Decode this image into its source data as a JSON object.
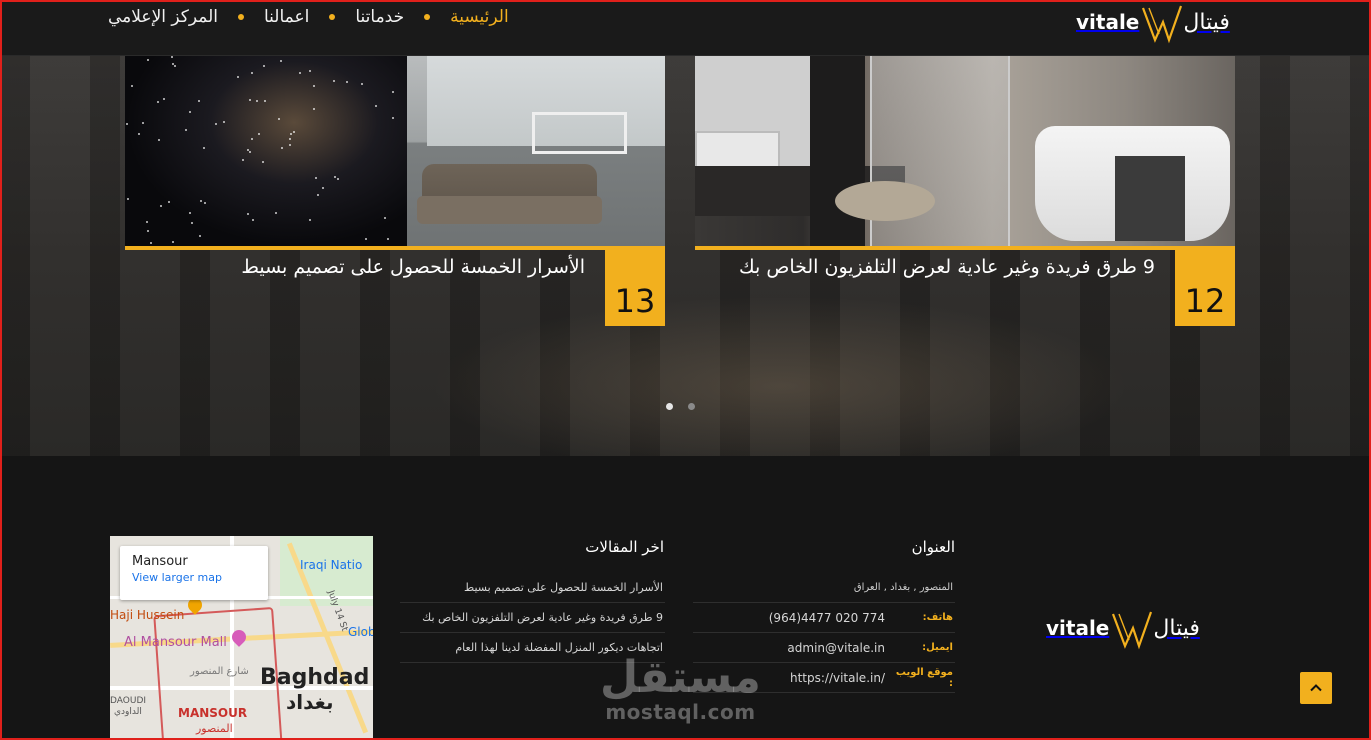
{
  "header": {
    "nav": [
      {
        "label": "الرئيسية",
        "active": true
      },
      {
        "label": "خدماتنا",
        "active": false
      },
      {
        "label": "اعمالنا",
        "active": false
      },
      {
        "label": "المركز الإعلامي",
        "active": false
      }
    ],
    "logo_latin": "vitale",
    "logo_arabic": "فيتال"
  },
  "slider": {
    "cards": [
      {
        "number": "12",
        "title": "9 طرق فريدة وغير عادية لعرض التلفزيون الخاص بك",
        "image": "bathroom-image"
      },
      {
        "number": "13",
        "title": "الأسرار الخمسة للحصول على تصميم بسيط",
        "image": "space-living-room-image"
      }
    ],
    "active_dot": 0,
    "dot_count": 2
  },
  "footer": {
    "address": {
      "title": "العنوان",
      "location": "المنصور , بغداد , العراق",
      "phone_label": "هاتف:",
      "phone": "(964)4477 020 774",
      "email_label": "ايميل:",
      "email": "admin@vitale.in",
      "website_label": "موقع الويب :",
      "website": "https://vitale.in/"
    },
    "latest_posts": {
      "title": "اخر المقالات",
      "items": [
        "الأسرار الخمسة للحصول على تصميم بسيط",
        "9 طرق فريدة وغير عادية لعرض التلفزيون الخاص بك",
        "اتجاهات ديكور المنزل المفضلة لدينا لهذا العام"
      ]
    },
    "map": {
      "place": "Mansour",
      "larger_map_link": "View larger map",
      "labels": {
        "baghdad": "Baghdad",
        "baghdad_ar": "بغداد",
        "mansour": "MANSOUR",
        "mansour_ar": "المنصور",
        "mall": "Al Mansour Mall",
        "hussein": "Haji Hussein",
        "iraqi": "Iraqi Natio",
        "glob": "Glob",
        "street": "July 14 St",
        "daoudi": "DAOUDI",
        "daoudi_ar": "الداودي",
        "street_ar": "شارع المنصور"
      }
    },
    "watermark_ar": "مستقل",
    "watermark_en": "mostaql.com"
  },
  "colors": {
    "accent": "#f2b01e",
    "background": "#151515",
    "frame": "#e0201b"
  }
}
